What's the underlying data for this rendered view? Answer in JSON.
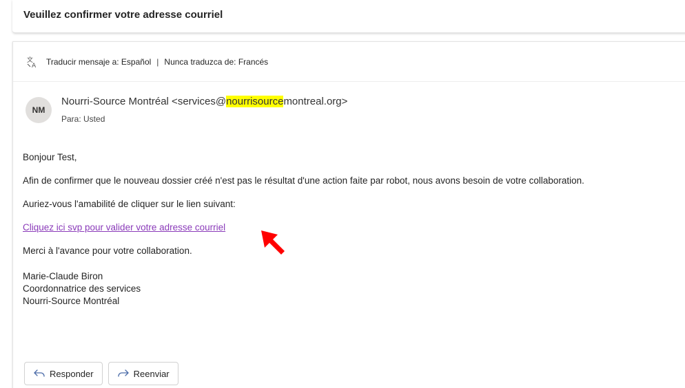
{
  "subject": "Veuillez confirmer votre adresse courriel",
  "translation_bar": {
    "translate_to": "Traducir mensaje a: Español",
    "separator": "|",
    "never_translate": "Nunca traduzca de: Francés",
    "icon": "translate-icon"
  },
  "sender": {
    "initials": "NM",
    "name_prefix": "Nourri-Source Montréal <services@",
    "name_highlight": "nourrisource",
    "name_suffix": "montreal.org>",
    "to": "Para: Usted"
  },
  "body": {
    "greeting": "Bonjour Test,",
    "paragraph1": "Afin de confirmer que le nouveau dossier créé n'est pas le résultat d'une action faite par robot, nous avons besoin de votre collaboration.",
    "paragraph2": "Auriez-vous l'amabilité de cliquer sur le lien suivant:",
    "link": "Cliquez ici svp pour valider votre adresse courriel",
    "thanks": "Merci à l'avance pour votre collaboration.",
    "signature": {
      "name": "Marie-Claude Biron",
      "title": "Coordonnatrice des services",
      "org": "Nourri-Source Montréal"
    }
  },
  "actions": {
    "reply": "Responder",
    "forward": "Reenviar"
  },
  "colors": {
    "link": "#8a3ab9",
    "highlight": "#ffff00",
    "arrow": "#ff0000",
    "avatar_bg": "#e1dfdd"
  }
}
